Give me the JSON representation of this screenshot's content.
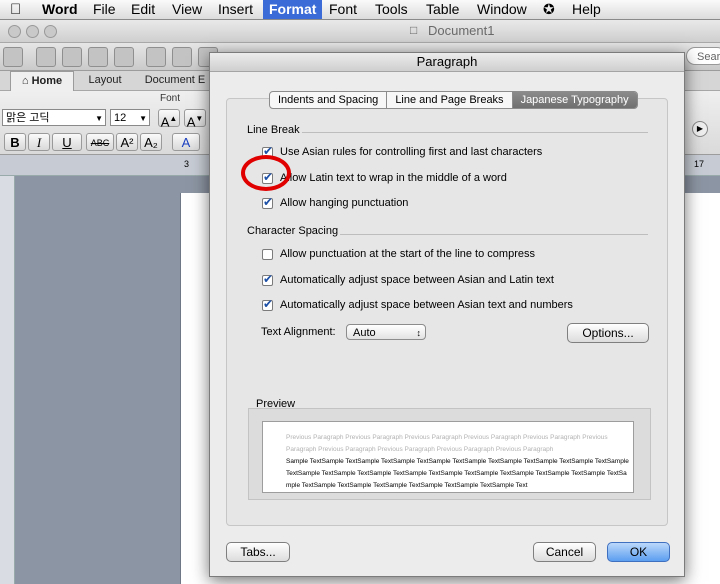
{
  "menubar": {
    "apple": "",
    "items": [
      "Word",
      "File",
      "Edit",
      "View",
      "Insert",
      "Format",
      "Font",
      "Tools",
      "Table",
      "Window",
      "Help"
    ],
    "script_icon": "script-menu-icon"
  },
  "window": {
    "title": "Document1",
    "search_text": "Sear"
  },
  "ribbon": {
    "tabs": [
      "Home",
      "Layout",
      "Document E"
    ],
    "font_group_label": "Font",
    "font_name": "맑은 고딕",
    "font_size": "12",
    "format_buttons": [
      "B",
      "I",
      "U",
      "ABC",
      "A²",
      "A₂"
    ],
    "ruler_left": "3",
    "ruler_right": "17"
  },
  "dialog": {
    "title": "Paragraph",
    "tabs": [
      "Indents and Spacing",
      "Line and Page Breaks",
      "Japanese Typography"
    ],
    "selected_tab": "Japanese Typography",
    "line_break": {
      "label": "Line Break",
      "options": [
        {
          "label": "Use Asian rules for controlling first and last characters",
          "checked": true
        },
        {
          "label": "Allow Latin text to wrap in the middle of a word",
          "checked": true
        },
        {
          "label": "Allow hanging punctuation",
          "checked": true
        }
      ]
    },
    "character_spacing": {
      "label": "Character Spacing",
      "options": [
        {
          "label": "Allow punctuation at the start of the line to compress",
          "checked": false
        },
        {
          "label": "Automatically adjust space between Asian and Latin text",
          "checked": true
        },
        {
          "label": "Automatically adjust space between Asian text and numbers",
          "checked": true
        }
      ]
    },
    "text_alignment_label": "Text Alignment:",
    "text_alignment_value": "Auto",
    "options_button": "Options...",
    "preview": {
      "label": "Preview",
      "lines": [
        "Previous Paragraph Previous Paragraph Previous Paragraph Previous Paragraph Previous Paragraph Previous",
        "Paragraph Previous Paragraph Previous Paragraph Previous Paragraph Previous Paragraph",
        "Sample TextSample TextSample TextSample TextSample TextSample TextSample TextSample TextSample TextSample",
        "TextSample TextSample TextSample TextSample TextSample TextSample TextSample TextSample TextSample TextSa",
        "mple TextSample TextSample TextSample TextSample TextSample TextSample Text"
      ]
    },
    "tabs_button": "Tabs...",
    "cancel_button": "Cancel",
    "ok_button": "OK"
  },
  "annotation": {
    "highlight_color": "#e00000"
  }
}
